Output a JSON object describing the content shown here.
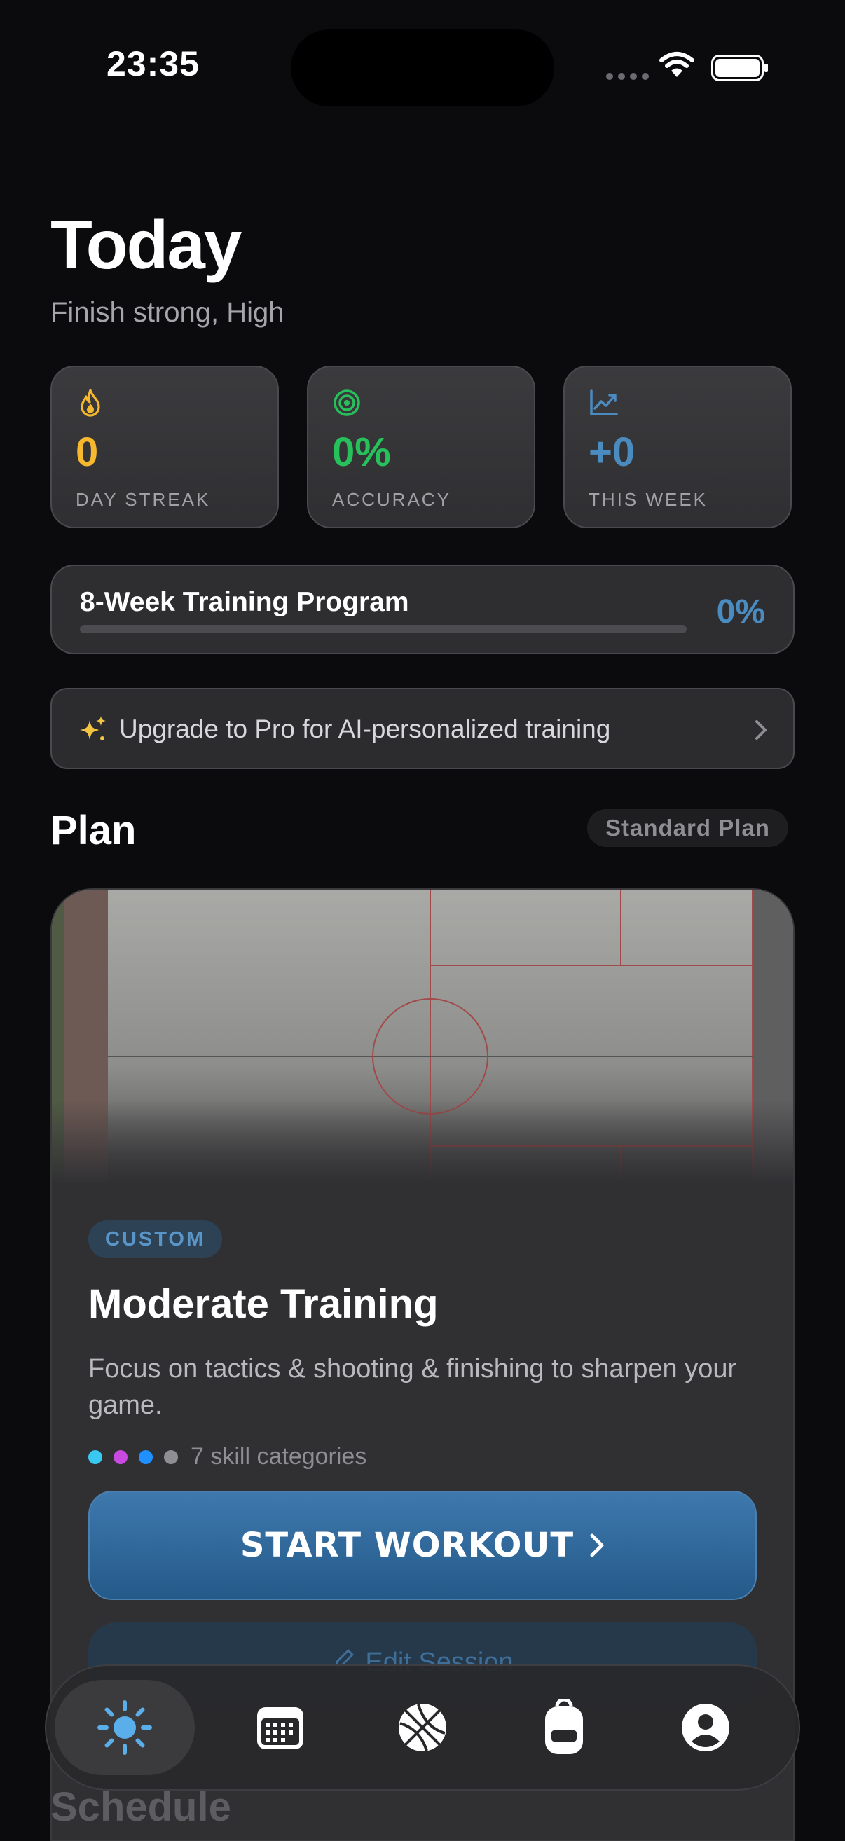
{
  "status_bar": {
    "time": "23:35"
  },
  "header": {
    "title": "Today",
    "subtitle": "Finish strong, High"
  },
  "stats": [
    {
      "value": "0",
      "label": "DAY STREAK",
      "color": "#f5b82e",
      "icon": "flame-icon"
    },
    {
      "value": "0%",
      "label": "ACCURACY",
      "color": "#27c15b",
      "icon": "target-icon"
    },
    {
      "value": "+0",
      "label": "THIS WEEK",
      "color": "#4a8bc0",
      "icon": "trend-chart-icon"
    }
  ],
  "program": {
    "title": "8-Week Training Program",
    "percent": "0%",
    "progress": 0
  },
  "upgrade": {
    "text": "Upgrade to Pro for AI-personalized training",
    "icon": "sparkles-icon"
  },
  "plan": {
    "title": "Plan",
    "badge": "Standard Plan"
  },
  "workout": {
    "badge": "CUSTOM",
    "title": "Moderate Training",
    "description": "Focus on tactics & shooting & finishing to sharpen your game.",
    "category_dots": [
      "#38c8f0",
      "#c84ae0",
      "#1e90ff",
      "#8e8e93"
    ],
    "categories_text": "7 skill categories",
    "start_label": "START WORKOUT",
    "edit_label": "Edit Session"
  },
  "next_section": {
    "title": "Schedule"
  },
  "tabbar": {
    "tabs": [
      {
        "name": "today",
        "icon": "sun-icon",
        "active": true
      },
      {
        "name": "calendar",
        "icon": "calendar-icon",
        "active": false
      },
      {
        "name": "drills",
        "icon": "basketball-icon",
        "active": false
      },
      {
        "name": "gear",
        "icon": "backpack-icon",
        "active": false
      },
      {
        "name": "profile",
        "icon": "profile-icon",
        "active": false
      }
    ]
  },
  "colors": {
    "accent": "#4a8bc0",
    "background": "#0b0b0d",
    "card": "#303033"
  }
}
